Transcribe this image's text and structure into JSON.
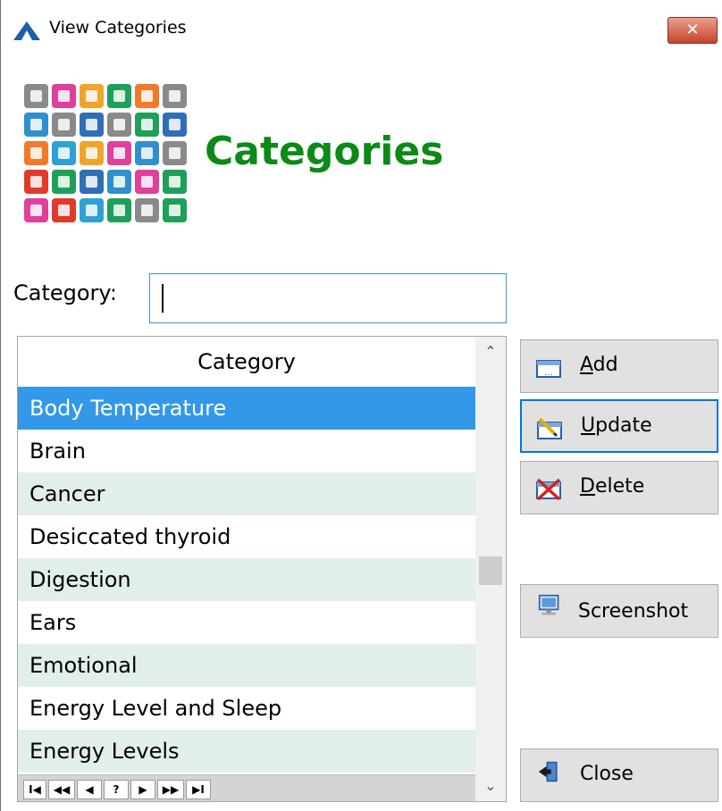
{
  "window": {
    "title": "View Categories",
    "close_label": "✕"
  },
  "heading": "Categories",
  "category_field": {
    "label": "Category:",
    "value": ""
  },
  "grid": {
    "column_header": "Category",
    "rows": [
      "Body Temperature",
      "Brain",
      "Cancer",
      "Desiccated thyroid",
      "Digestion",
      "Ears",
      "Emotional",
      "Energy Level and Sleep",
      "Energy Levels"
    ],
    "selected_index": 0
  },
  "navigator": {
    "first": "I◀",
    "prev_page": "◀◀",
    "prev": "◀",
    "help": "?",
    "next": "▶",
    "next_page": "▶▶",
    "last": "▶I"
  },
  "buttons": {
    "add": "Add",
    "update": "Update",
    "delete": "Delete",
    "screenshot": "Screenshot",
    "close": "Close"
  },
  "colors": {
    "heading": "#0c8a17",
    "selection": "#3398e8",
    "alt_row": "#e2eeec"
  }
}
